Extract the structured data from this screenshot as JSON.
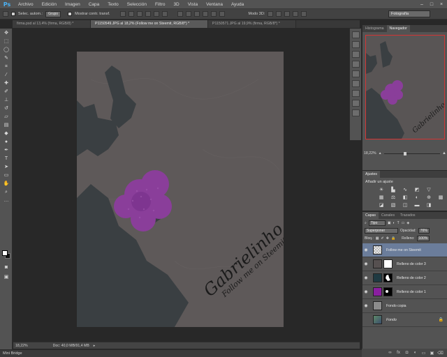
{
  "app": {
    "logo": "Ps"
  },
  "menu": [
    "Archivo",
    "Edición",
    "Imagen",
    "Capa",
    "Texto",
    "Selección",
    "Filtro",
    "3D",
    "Vista",
    "Ventana",
    "Ayuda"
  ],
  "options": {
    "auto_select_label": "Selec. autom.:",
    "auto_select_value": "Grupo",
    "show_transform_label": "Mostrar contr. transf.",
    "mode_3d_label": "Modo 3D:",
    "workspace": "Fotografía"
  },
  "tabs": [
    {
      "label": "firma.psd al 13,4% (firma, RGB/8) *",
      "active": false
    },
    {
      "label": "P1150549.JPG al 18,2% (Follow me on Steemit, RGB/8*) *",
      "active": true
    },
    {
      "label": "P1150571.JPG al 19,9% (firma, RGB/8*) *",
      "active": false
    }
  ],
  "canvas": {
    "signature": "Gabrielinho",
    "tagline": "Follow me on Steemit"
  },
  "status": {
    "zoom": "18,22%",
    "doc": "Doc: 40,0 MB/91,4 MB"
  },
  "mini_bridge": "Mini Bridge",
  "navigator": {
    "tabs": [
      "Histograma",
      "Navegador"
    ],
    "active_tab": "Navegador",
    "zoom": "18,22%"
  },
  "adjustments": {
    "tab": "Ajustes",
    "title": "Añadir un ajuste"
  },
  "layers_panel": {
    "tabs": [
      "Capas",
      "Canales",
      "Trazados"
    ],
    "filter": "Tipo",
    "blend_mode": "Superponer",
    "opacity_label": "Opacidad:",
    "opacity": "76%",
    "lock_label": "Bloq.:",
    "fill_label": "Relleno:",
    "fill": "100%",
    "layers": [
      {
        "name": "Follow me on Steemit",
        "kind": "text",
        "visible": true,
        "selected": true,
        "thumb_color": "#e6e6e6"
      },
      {
        "name": "Relleno de color 3",
        "kind": "fill",
        "visible": true,
        "selected": false,
        "thumb_color": "#565050"
      },
      {
        "name": "Relleno de color 2",
        "kind": "fill",
        "visible": true,
        "selected": false,
        "thumb_color": "#1f3a42"
      },
      {
        "name": "Relleno de color 1",
        "kind": "fill",
        "visible": true,
        "selected": false,
        "thumb_color": "#8a1fa0"
      },
      {
        "name": "Fondo copia",
        "kind": "pixel",
        "visible": true,
        "selected": false,
        "thumb_color": "#8c8c8c"
      },
      {
        "name": "Fondo",
        "kind": "background",
        "visible": false,
        "selected": false,
        "thumb_color": "#5f8a6a"
      }
    ]
  },
  "colors": {
    "accent": "#4ab1f3",
    "flower": "#8a3e9a",
    "canvas_bg": "#5e5959",
    "leaf": "#3a3f42",
    "selected_layer": "#6b7d9b",
    "nav_frame": "#d43535"
  }
}
